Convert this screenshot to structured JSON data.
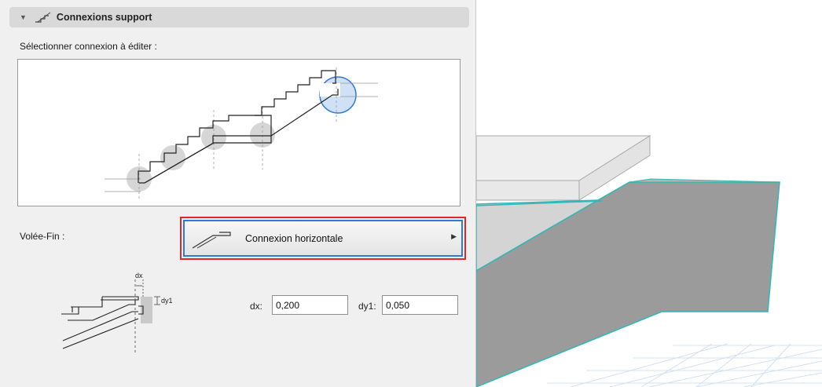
{
  "section": {
    "title": "Connexions support"
  },
  "selector": {
    "label": "Sélectionner connexion à éditer :"
  },
  "connection": {
    "row_label": "Volée-Fin :",
    "selected_value": "Connexion horizontale"
  },
  "detail_diagram": {
    "dx_label": "dx",
    "dy1_label": "dy1"
  },
  "dimensions": {
    "dx_label": "dx:",
    "dx_value": "0,200",
    "dy1_label": "dy1:",
    "dy1_value": "0,050"
  },
  "colors": {
    "highlight_outline": "#e02828",
    "focus_border": "#2f7bd4",
    "selection_fill": "#cfe0f7",
    "model_edge": "#2fb8b8",
    "model_fill": "#9b9b9b"
  }
}
